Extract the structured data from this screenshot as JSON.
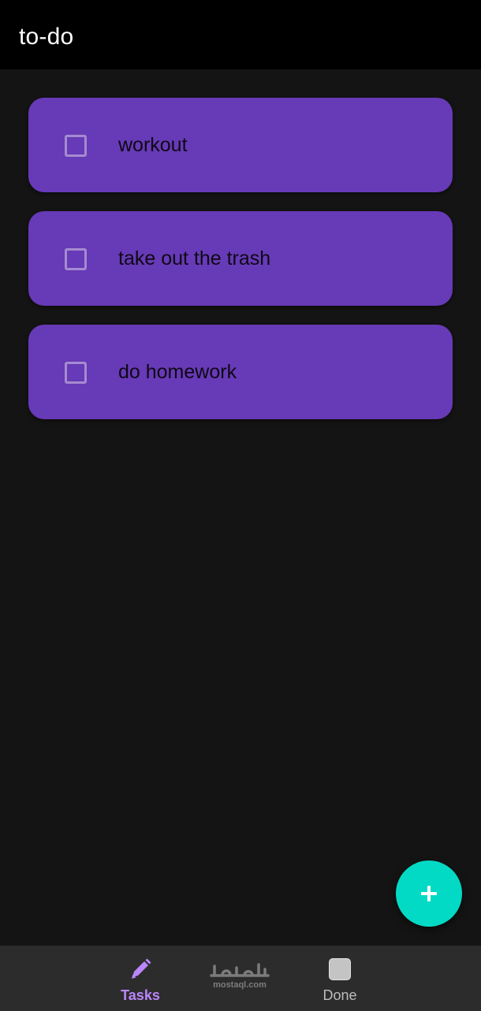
{
  "app_bar": {
    "title": "to-do"
  },
  "tasks": [
    {
      "label": "workout",
      "checked": false
    },
    {
      "label": "take out the trash",
      "checked": false
    },
    {
      "label": "do homework",
      "checked": false
    }
  ],
  "fab": {
    "icon": "plus-icon"
  },
  "bottom_nav": {
    "items": [
      {
        "label": "Tasks",
        "icon": "pencil-icon",
        "active": true
      },
      {
        "label": "Done",
        "icon": "square-icon",
        "active": false
      }
    ]
  },
  "watermark": {
    "text": "mostaql.com",
    "logo_text": "مستقل"
  },
  "colors": {
    "background": "#141414",
    "app_bar": "#000000",
    "card": "#673ab7",
    "fab": "#03dac5",
    "nav_active": "#bb86fc",
    "nav_bar": "#2c2c2c"
  }
}
